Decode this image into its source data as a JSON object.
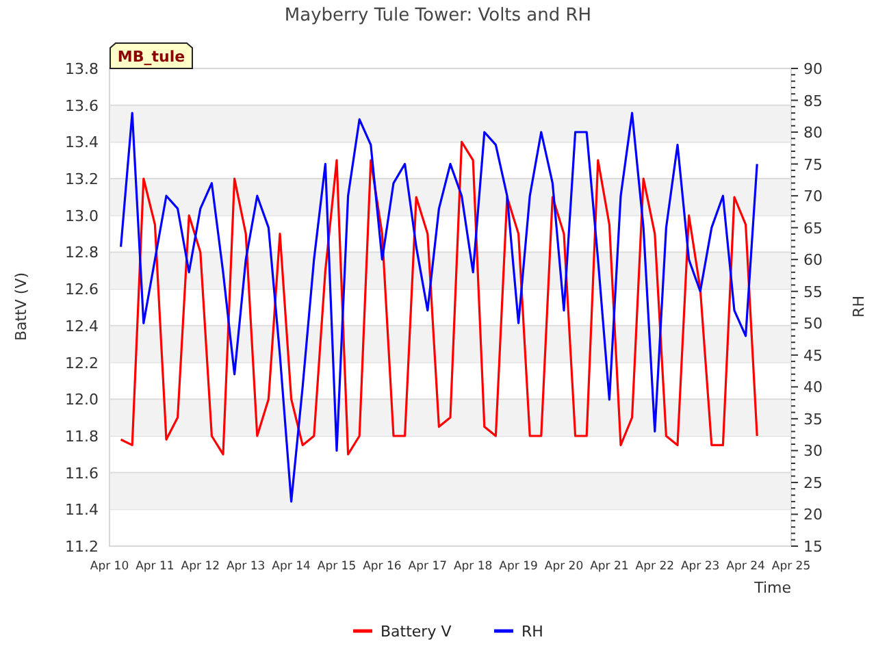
{
  "chart": {
    "station_badge": "MB_tule",
    "chart_data": {
      "type": "line",
      "title": "Mayberry Tule Tower: Volts and RH",
      "xlabel": "Time",
      "ylabel": "BattV (V)",
      "y2label": "RH",
      "grid": true,
      "legend": true,
      "ylim": [
        11.2,
        13.8
      ],
      "y2lim": [
        15,
        90
      ],
      "categories": [
        "Apr 10",
        null,
        null,
        null,
        "Apr 11",
        null,
        null,
        null,
        "Apr 12",
        null,
        null,
        null,
        "Apr 13",
        null,
        null,
        null,
        "Apr 14",
        null,
        null,
        null,
        "Apr 15",
        null,
        null,
        null,
        "Apr 16",
        null,
        null,
        null,
        "Apr 17",
        null,
        null,
        null,
        "Apr 18",
        null,
        null,
        null,
        "Apr 19",
        null,
        null,
        null,
        "Apr 20",
        null,
        null,
        null,
        "Apr 21",
        null,
        null,
        null,
        "Apr 22",
        null,
        null,
        null,
        "Apr 23",
        null,
        null,
        null,
        "Apr 24",
        null,
        null,
        null,
        "Apr 25"
      ],
      "yticks": [
        {
          "value": 11.2,
          "label": "11.2"
        },
        {
          "value": 11.4,
          "label": "11.4"
        },
        {
          "value": 11.6,
          "label": "11.6"
        },
        {
          "value": 11.8,
          "label": "11.8"
        },
        {
          "value": 12.0,
          "label": "12.0"
        },
        {
          "value": 12.2,
          "label": "12.2"
        },
        {
          "value": 12.4,
          "label": "12.4"
        },
        {
          "value": 12.6,
          "label": "12.6"
        },
        {
          "value": 12.8,
          "label": "12.8"
        },
        {
          "value": 13.0,
          "label": "13.0"
        },
        {
          "value": 13.2,
          "label": "13.2"
        },
        {
          "value": 13.4,
          "label": "13.4"
        },
        {
          "value": 13.6,
          "label": "13.6"
        },
        {
          "value": 13.8,
          "label": "13.8"
        }
      ],
      "y2ticks": [
        15,
        20,
        25,
        30,
        35,
        40,
        45,
        50,
        55,
        60,
        65,
        70,
        75,
        80,
        85,
        90
      ],
      "series": [
        {
          "name": "Battery V",
          "color": "#ff0000",
          "values": [
            null,
            11.78,
            11.75,
            13.2,
            12.95,
            11.78,
            11.9,
            13.0,
            12.8,
            11.8,
            11.7,
            13.2,
            12.9,
            11.8,
            12.0,
            12.9,
            12.0,
            11.75,
            11.8,
            12.7,
            13.3,
            11.7,
            11.8,
            13.3,
            12.9,
            11.8,
            11.8,
            13.1,
            12.9,
            11.85,
            11.9,
            13.4,
            13.3,
            11.85,
            11.8,
            13.1,
            12.9,
            11.8,
            11.8,
            13.1,
            12.9,
            11.8,
            11.8,
            13.3,
            12.95,
            11.75,
            11.9,
            13.2,
            12.9,
            11.8,
            11.75,
            13.0,
            12.6,
            11.75,
            11.75,
            13.1,
            12.95,
            11.8,
            null,
            null,
            null
          ]
        },
        {
          "name": "RH",
          "color": "#0000ff",
          "axis": "y2",
          "values": [
            null,
            62,
            83,
            50,
            60,
            70,
            68,
            58,
            68,
            72,
            58,
            42,
            60,
            70,
            65,
            45,
            22,
            40,
            60,
            75,
            30,
            70,
            82,
            78,
            60,
            72,
            75,
            62,
            52,
            68,
            75,
            70,
            58,
            80,
            78,
            70,
            50,
            70,
            80,
            72,
            52,
            80,
            80,
            60,
            38,
            70,
            83,
            65,
            33,
            65,
            78,
            60,
            55,
            65,
            70,
            52,
            48,
            75,
            null,
            null,
            null
          ]
        }
      ]
    }
  }
}
